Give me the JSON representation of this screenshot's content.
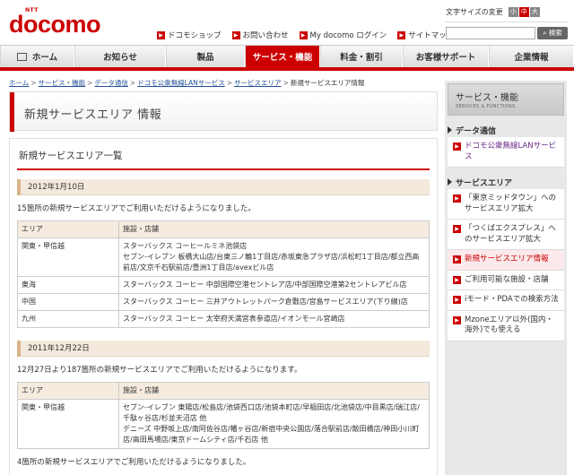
{
  "header": {
    "ntt": "NTT",
    "brand": "docomo",
    "util_links": [
      {
        "label": "ドコモショップ"
      },
      {
        "label": "お問い合わせ"
      },
      {
        "label": "My docomo ログイン"
      },
      {
        "label": "サイトマップ"
      }
    ],
    "font_size_label": "文字サイズの変更",
    "font_sizes": [
      "小",
      "中",
      "大"
    ],
    "search_button": "検索"
  },
  "nav": {
    "items": [
      {
        "label": "ホーム"
      },
      {
        "label": "お知らせ"
      },
      {
        "label": "製品"
      },
      {
        "label": "サービス・機能"
      },
      {
        "label": "料金・割引"
      },
      {
        "label": "お客様サポート"
      },
      {
        "label": "企業情報"
      }
    ]
  },
  "breadcrumb": {
    "items": [
      "ホーム",
      "サービス・機能",
      "データ通信",
      "ドコモ公衆無線LANサービス",
      "サービスエリア",
      "新規サービスエリア情報"
    ],
    "sep": ">"
  },
  "main": {
    "page_title": "新規サービスエリア 情報",
    "section_title": "新規サービスエリア一覧",
    "blocks": [
      {
        "date": "2012年1月10日",
        "intro": "15箇所の新規サービスエリアでご利用いただけるようになりました。",
        "col_area": "エリア",
        "col_facility": "施設・店舗",
        "rows": [
          {
            "area": "関東・甲信越",
            "facility": "スターバックス コーヒールミネ池袋店\nセブン-イレブン 板橋大山店/台東三ノ輪1丁目店/赤坂東急プラザ店/浜松町1丁目店/都立西高前店/文京千石駅前店/豊洲1丁目店/avexビル店"
          },
          {
            "area": "東海",
            "facility": "スターバックス コーヒー 中部国際空港セントレア店/中部国際空港第2セントレアビル店"
          },
          {
            "area": "中国",
            "facility": "スターバックス コーヒー 三井アウトレットパーク倉敷店/宮島サービスエリア(下り線)店"
          },
          {
            "area": "九州",
            "facility": "スターバックス コーヒー 太宰府天満宮表参道店/イオンモール宮崎店"
          }
        ]
      },
      {
        "date": "2011年12月22日",
        "intro": "12月27日より187箇所の新規サービスエリアでご利用いただけるようになります。",
        "col_area": "エリア",
        "col_facility": "施設・店舗",
        "rows": [
          {
            "area": "関東・甲信越",
            "facility": "セブン-イレブン 東陽店/松島店/池袋西口店/池袋本町店/早稲田店/北池袋店/中目黒店/瑞江店/千駄ヶ谷店/杉並天沼店 他\nデニーズ 中野坂上店/南阿佐谷店/幡ヶ谷店/新宿中央公園店/落合駅前店/飯田橋店/神田小川町店/高田馬場店/東京ドームシティ店/千石店 他"
          }
        ]
      }
    ],
    "footer_text": "4箇所の新規サービスエリアでご利用いただけるようになりました。"
  },
  "sidebar": {
    "title": "サービス・機能",
    "subtitle": "SERVICES & FUNCTIONS",
    "cat1": "データ通信",
    "cat1_item": "ドコモ公衆無線LANサービス",
    "cat2": "サービスエリア",
    "items": [
      {
        "label": "「東京ミッドタウン」へのサービスエリア拡大"
      },
      {
        "label": "「つくばエクスプレス」へのサービスエリア拡大"
      },
      {
        "label": "新規サービスエリア情報"
      },
      {
        "label": "ご利用可能な施設・店舗"
      },
      {
        "label": "iモード・PDAでの検索方法"
      },
      {
        "label": "Mzoneエリア以外(国内・海外)でも使える"
      }
    ]
  }
}
